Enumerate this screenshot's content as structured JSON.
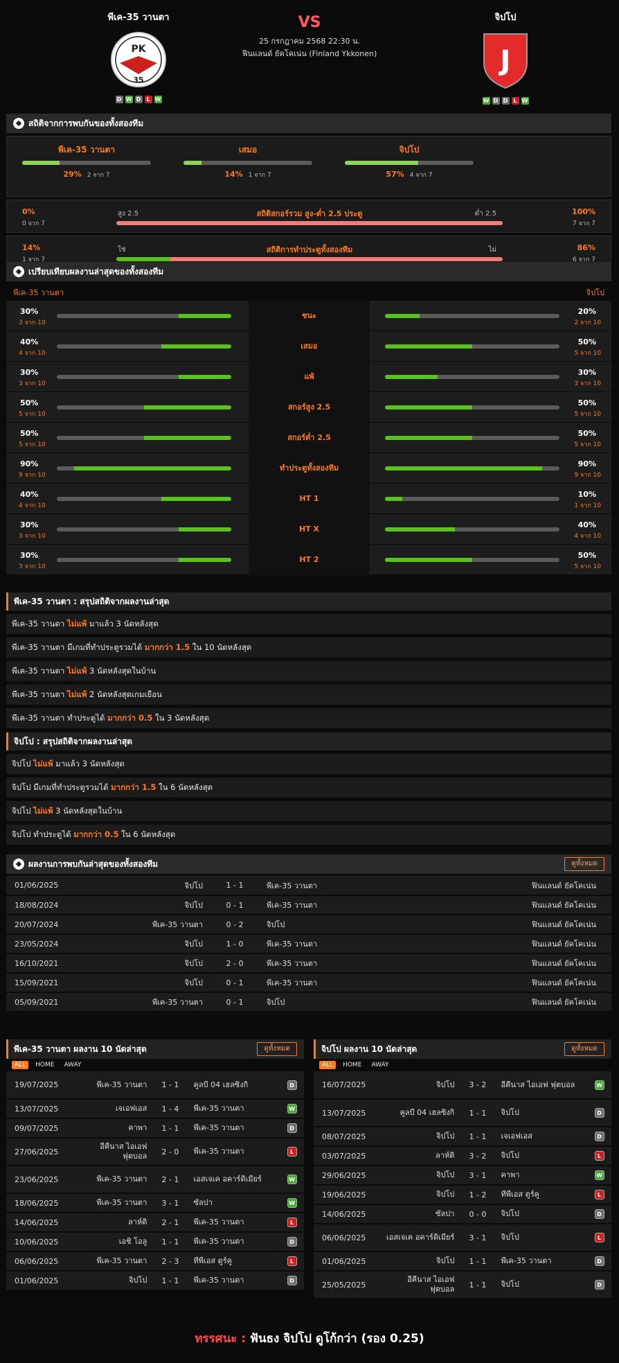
{
  "header": {
    "home": "พีเค-35 วานตา",
    "away": "จิปโป",
    "vs": "VS",
    "date": "25 กรกฎาคม 2568 22:30 น.",
    "league": "ฟินแลนด์ ยัคโคเน่น (Finland Ykkonen)",
    "home_form": [
      "D",
      "W",
      "D",
      "L",
      "W"
    ],
    "away_form": [
      "W",
      "D",
      "D",
      "L",
      "W"
    ]
  },
  "h2h_stats": {
    "title": "สถิติจากการพบกันของทั้งสองทีม",
    "cols": [
      {
        "label": "พีเค-35 วานตา",
        "pct": "29%",
        "sub": "2 จาก 7",
        "fill": 29
      },
      {
        "label": "เสมอ",
        "pct": "14%",
        "sub": "1 จาก 7",
        "fill": 14
      },
      {
        "label": "จิปโป",
        "pct": "57%",
        "sub": "4 จาก 7",
        "fill": 57
      }
    ],
    "ou": {
      "left_pct": "0%",
      "left_sub": "0 จาก 7",
      "left_label": "สูง 2.5",
      "title": "สถิติสกอร์รวม สูง-ต่ำ 2.5 ประตู",
      "right_label": "ต่ำ 2.5",
      "right_pct": "100%",
      "right_sub": "7 จาก 7",
      "fill": 0
    },
    "btts": {
      "left_pct": "14%",
      "left_sub": "1 จาก 7",
      "left_label": "ใช่",
      "title": "สถิติการทำประตูทั้งสองทีม",
      "right_label": "ไม่",
      "right_pct": "86%",
      "right_sub": "6 จาก 7",
      "fill": 14
    }
  },
  "compare": {
    "title": "เปรียบเทียบผลงานล่าสุดของทั้งสองทีม",
    "home": "พีเค-35 วานตา",
    "away": "จิปโป",
    "rows": [
      {
        "label": "ชนะ",
        "hp": "30%",
        "hs": "3 จาก 10",
        "hf": 30,
        "ap": "20%",
        "as": "2 จาก 10",
        "af": 20
      },
      {
        "label": "เสมอ",
        "hp": "40%",
        "hs": "4 จาก 10",
        "hf": 40,
        "ap": "50%",
        "as": "5 จาก 10",
        "af": 50
      },
      {
        "label": "แพ้",
        "hp": "30%",
        "hs": "3 จาก 10",
        "hf": 30,
        "ap": "30%",
        "as": "3 จาก 10",
        "af": 30
      },
      {
        "label": "สกอร์สูง 2.5",
        "hp": "50%",
        "hs": "5 จาก 10",
        "hf": 50,
        "ap": "50%",
        "as": "5 จาก 10",
        "af": 50
      },
      {
        "label": "สกอร์ต่ำ 2.5",
        "hp": "50%",
        "hs": "5 จาก 10",
        "hf": 50,
        "ap": "50%",
        "as": "5 จาก 10",
        "af": 50
      },
      {
        "label": "ทำประตูทั้งสองทีม",
        "hp": "90%",
        "hs": "9 จาก 10",
        "hf": 90,
        "ap": "90%",
        "as": "9 จาก 10",
        "af": 90
      },
      {
        "label": "HT 1",
        "hp": "40%",
        "hs": "4 จาก 10",
        "hf": 40,
        "ap": "10%",
        "as": "1 จาก 10",
        "af": 10
      },
      {
        "label": "HT X",
        "hp": "30%",
        "hs": "3 จาก 10",
        "hf": 30,
        "ap": "40%",
        "as": "4 จาก 10",
        "af": 40
      },
      {
        "label": "HT 2",
        "hp": "30%",
        "hs": "3 จาก 10",
        "hf": 30,
        "ap": "50%",
        "as": "5 จาก 10",
        "af": 50
      }
    ]
  },
  "home_summary": {
    "title": "พีเค-35 วานตา : สรุปสถิติจากผลงานล่าสุด",
    "rows": [
      [
        "พีเค-35 วานตา ",
        "ไม่แพ้",
        " มาแล้ว 3 นัดหลังสุด"
      ],
      [
        "พีเค-35 วานตา มีเกมที่ทำประตูรวมได้ ",
        "มากกว่า 1.5",
        " ใน 10 นัดหลังสุด"
      ],
      [
        "พีเค-35 วานตา ",
        "ไม่แพ้",
        " 3  นัดหลังสุดในบ้าน"
      ],
      [
        "พีเค-35 วานตา ",
        "ไม่แพ้",
        " 2  นัดหลังสุดเกมเยือน"
      ],
      [
        "พีเค-35 วานตา ทำประตูได้ ",
        "มากกว่า 0.5",
        " ใน 3 นัดหลังสุด"
      ]
    ]
  },
  "away_summary": {
    "title": "จิปโป : สรุปสถิติจากผลงานล่าสุด",
    "rows": [
      [
        "จิปโป ",
        "ไม่แพ้",
        " มาแล้ว 3 นัดหลังสุด"
      ],
      [
        "จิปโป มีเกมที่ทำประตูรวมได้ ",
        "มากกว่า 1.5",
        " ใน 6 นัดหลังสุด"
      ],
      [
        "จิปโป ",
        "ไม่แพ้",
        " 3  นัดหลังสุดในบ้าน"
      ],
      [
        "จิปโป ทำประตูได้ ",
        "มากกว่า 0.5",
        " ใน 6 นัดหลังสุด"
      ]
    ]
  },
  "h2h": {
    "title": "ผลงานการพบกันล่าสุดของทั้งสองทีม",
    "btn": "ดูทั้งหมด",
    "rows": [
      [
        "01/06/2025",
        "จิปโป",
        "1 - 1",
        "พีเค-35 วานตา",
        "ฟินแลนด์ ยัคโคเน่น"
      ],
      [
        "18/08/2024",
        "จิปโป",
        "0 - 1",
        "พีเค-35 วานตา",
        "ฟินแลนด์ ยัคโคเน่น"
      ],
      [
        "20/07/2024",
        "พีเค-35 วานตา",
        "0 - 2",
        "จิปโป",
        "ฟินแลนด์ ยัคโคเน่น"
      ],
      [
        "23/05/2024",
        "จิปโป",
        "1 - 0",
        "พีเค-35 วานตา",
        "ฟินแลนด์ ยัคโคเน่น"
      ],
      [
        "16/10/2021",
        "จิปโป",
        "2 - 0",
        "พีเค-35 วานตา",
        "ฟินแลนด์ ยัคโคเน่น"
      ],
      [
        "15/09/2021",
        "จิปโป",
        "0 - 1",
        "พีเค-35 วานตา",
        "ฟินแลนด์ ยัคโคเน่น"
      ],
      [
        "05/09/2021",
        "พีเค-35 วานตา",
        "0 - 1",
        "จิปโป",
        "ฟินแลนด์ ยัคโคเน่น"
      ]
    ]
  },
  "home_last": {
    "title": "พีเค-35 วานตา ผลงาน 10 นัดล่าสุด",
    "btn": "ดูทั้งหมด",
    "tabs": [
      "ALL",
      "HOME",
      "AWAY"
    ],
    "rows": [
      [
        "19/07/2025",
        "พีเค-35 วานตา",
        "1 - 1",
        "คูลบี 04 เฮลซิงกิ",
        "D"
      ],
      [
        "13/07/2025",
        "เจเอฟเอส",
        "1 - 4",
        "พีเค-35 วานตา",
        "W"
      ],
      [
        "09/07/2025",
        "คาพา",
        "1 - 1",
        "พีเค-35 วานตา",
        "D"
      ],
      [
        "27/06/2025",
        "อีคีนาส ไอเอฟ ฟุตบอล",
        "2 - 0",
        "พีเค-35 วานตา",
        "L"
      ],
      [
        "23/06/2025",
        "พีเค-35 วานตา",
        "2 - 1",
        "เอสเจเค อคาร์ดิเมียร์",
        "W"
      ],
      [
        "18/06/2025",
        "พีเค-35 วานตา",
        "3 - 1",
        "ซัลปา",
        "W"
      ],
      [
        "14/06/2025",
        "ลาห์ติ",
        "2 - 1",
        "พีเค-35 วานตา",
        "L"
      ],
      [
        "10/06/2025",
        "เอชิ โอลู",
        "1 - 1",
        "พีเค-35 วานตา",
        "D"
      ],
      [
        "06/06/2025",
        "พีเค-35 วานตา",
        "2 - 3",
        "ทีพีเอส ตูร์คู",
        "L"
      ],
      [
        "01/06/2025",
        "จิปโป",
        "1 - 1",
        "พีเค-35 วานตา",
        "D"
      ]
    ]
  },
  "away_last": {
    "title": "จิปโป ผลงาน 10 นัดล่าสุด",
    "btn": "ดูทั้งหมด",
    "tabs": [
      "ALL",
      "HOME",
      "AWAY"
    ],
    "rows": [
      [
        "16/07/2025",
        "จิปโป",
        "3 - 2",
        "อีคีนาส ไอเอฟ ฟุตบอล",
        "W"
      ],
      [
        "13/07/2025",
        "คูลบี 04 เฮลซิงกิ",
        "1 - 1",
        "จิปโป",
        "D"
      ],
      [
        "08/07/2025",
        "จิปโป",
        "1 - 1",
        "เจเอฟเอส",
        "D"
      ],
      [
        "03/07/2025",
        "ลาห์ติ",
        "3 - 2",
        "จิปโป",
        "L"
      ],
      [
        "29/06/2025",
        "จิปโป",
        "3 - 1",
        "คาพา",
        "W"
      ],
      [
        "19/06/2025",
        "จิปโป",
        "1 - 2",
        "ทีพีเอส ตูร์คู",
        "L"
      ],
      [
        "14/06/2025",
        "ซัลปา",
        "0 - 0",
        "จิปโป",
        "D"
      ],
      [
        "06/06/2025",
        "เอสเจเค อคาร์ดิเมียร์",
        "3 - 1",
        "จิปโป",
        "L"
      ],
      [
        "01/06/2025",
        "จิปโป",
        "1 - 1",
        "พีเค-35 วานตา",
        "D"
      ],
      [
        "25/05/2025",
        "อีคีนาส ไอเอฟ ฟุตบอล",
        "1 - 1",
        "จิปโป",
        "D"
      ]
    ]
  },
  "footer": {
    "label": "ทรรศนะ :",
    "text": " ฟันธง จิปโป ดูโก้กว่า (รอง 0.25)"
  },
  "colors": {
    "accent": "#ff7a1a",
    "win": "#43b02a",
    "loss": "#d0201e",
    "draw": "#707070",
    "bar": "#5ac31a"
  }
}
